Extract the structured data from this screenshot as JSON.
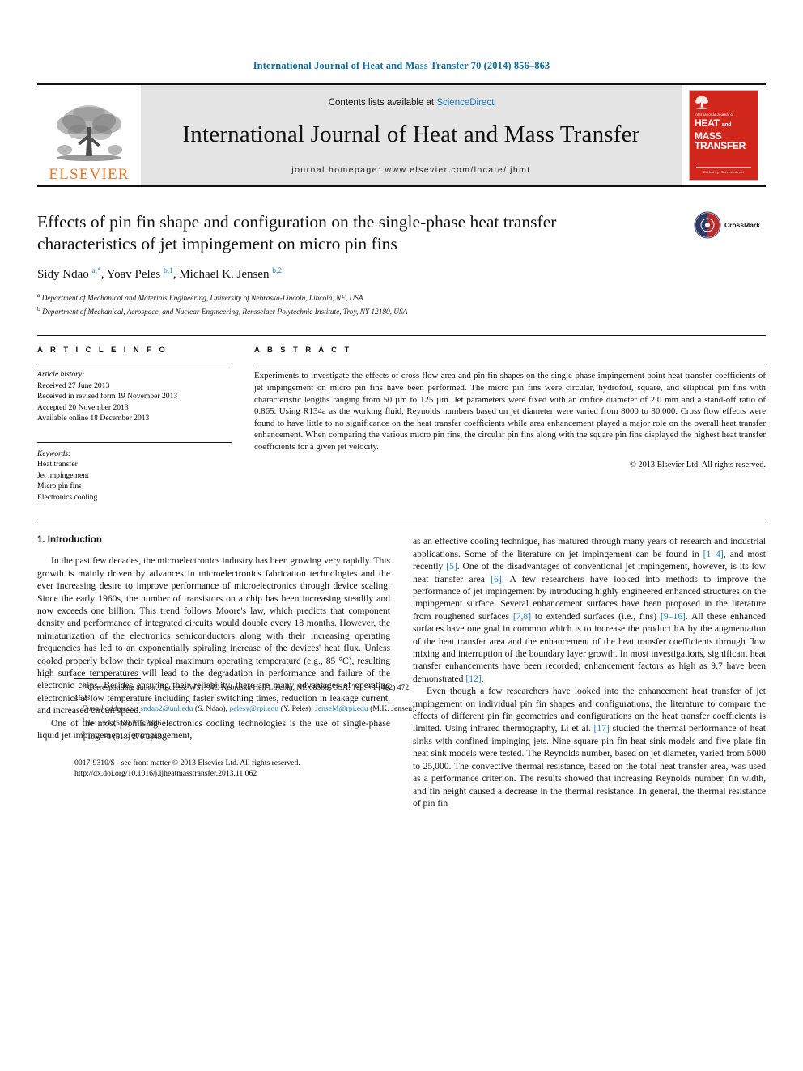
{
  "running_head": "International Journal of Heat and Mass Transfer 70 (2014) 856–863",
  "masthead": {
    "publisher": "ELSEVIER",
    "contents_prefix": "Contents lists available at ",
    "contents_link": "ScienceDirect",
    "journal_name": "International Journal of Heat and Mass Transfer",
    "homepage": "journal homepage: www.elsevier.com/locate/ijhmt",
    "cover": {
      "small_title": "International Journal of",
      "big_line1": "HEAT",
      "big_and": "and",
      "big_line1b": "MASS",
      "big_line2": "TRANSFER",
      "footer": "Edited by: Sciencedirect"
    }
  },
  "article": {
    "title": "Effects of pin fin shape and configuration on the single-phase heat transfer characteristics of jet impingement on micro pin fins",
    "authors_html": "Sidy Ndao <sup>a,*</sup>, Yoav Peles <sup>b,1</sup>, Michael K. Jensen <sup>b,2</sup>",
    "affiliation_a": "Department of Mechanical and Materials Engineering, University of Nebraska-Lincoln, Lincoln, NE, USA",
    "affiliation_b": "Department of Mechanical, Aerospace, and Nuclear Engineering, Rensselaer Polytechnic Institute, Troy, NY 12180, USA",
    "crossmark_label": "CrossMark"
  },
  "info": {
    "heading": "A R T I C L E    I N F O",
    "history_label": "Article history:",
    "history": [
      "Received 27 June 2013",
      "Received in revised form 19 November 2013",
      "Accepted 20 November 2013",
      "Available online 18 December 2013"
    ],
    "keywords_label": "Keywords:",
    "keywords": [
      "Heat transfer",
      "Jet impingement",
      "Micro pin fins",
      "Electronics cooling"
    ]
  },
  "abstract": {
    "heading": "A B S T R A C T",
    "text": "Experiments to investigate the effects of cross flow area and pin fin shapes on the single-phase impingement point heat transfer coefficients of jet impingement on micro pin fins have been performed. The micro pin fins were circular, hydrofoil, square, and elliptical pin fins with characteristic lengths ranging from 50 µm to 125 µm. Jet parameters were fixed with an orifice diameter of 2.0 mm and a stand-off ratio of 0.865. Using R134a as the working fluid, Reynolds numbers based on jet diameter were varied from 8000 to 80,000. Cross flow effects were found to have little to no significance on the heat transfer coefficients while area enhancement played a major role on the overall heat transfer enhancement. When comparing the various micro pin fins, the circular pin fins along with the square pin fins displayed the highest heat transfer coefficients for a given jet velocity.",
    "copyright": "© 2013 Elsevier Ltd. All rights reserved."
  },
  "body": {
    "section_title": "1. Introduction",
    "left_p1": "In the past few decades, the microelectronics industry has been growing very rapidly. This growth is mainly driven by advances in microelectronics fabrication technologies and the ever increasing desire to improve performance of microelectronics through device scaling. Since the early 1960s, the number of transistors on a chip has been increasing steadily and now exceeds one billion. This trend follows Moore's law, which predicts that component density and performance of integrated circuits would double every 18 months. However, the miniaturization of the electronics semiconductors along with their increasing operating frequencies has led to an exponentially spiraling increase of the devices' heat flux. Unless cooled properly below their typical maximum operating temperature (e.g., 85 °C), resulting high surface temperatures will lead to the degradation in performance and failure of the electronic chips. Besides ensuring their reliability, there are many advantages of operating electronics at low temperature including faster switching times, reduction in leakage current, and increased circuit speed.",
    "left_p2": "One of the most promising electronics cooling technologies is the use of single-phase liquid jet impingement. Jet impingement,",
    "right_p1_a": "as an effective cooling technique, has matured through many years of research and industrial applications. Some of the literature on jet impingement can be found in ",
    "right_ref_1_4": "[1–4]",
    "right_p1_b": ", and most recently ",
    "right_ref_5": "[5]",
    "right_p1_c": ". One of the disadvantages of conventional jet impingement, however, is its low heat transfer area ",
    "right_ref_6": "[6]",
    "right_p1_d": ". A few researchers have looked into methods to improve the performance of jet impingement by introducing highly engineered enhanced structures on the impingement surface. Several enhancement surfaces have been proposed in the literature from roughened surfaces ",
    "right_ref_78": "[7,8]",
    "right_p1_e": " to extended surfaces (i.e., fins) ",
    "right_ref_916": "[9–16]",
    "right_p1_f": ". All these enhanced surfaces have one goal in common which is to increase the product hA by the augmentation of the heat transfer area and the enhancement of the heat transfer coefficients through flow mixing and interruption of the boundary layer growth. In most investigations, significant heat transfer enhancements have been recorded; enhancement factors as high as 9.7 have been demonstrated ",
    "right_ref_12": "[12]",
    "right_p1_g": ".",
    "right_p2_a": "Even though a few researchers have looked into the enhancement heat transfer of jet impingement on individual pin fin shapes and configurations, the literature to compare the effects of different pin fin geometries and configurations on the heat transfer coefficients is limited. Using infrared thermography, Li et al. ",
    "right_ref_17": "[17]",
    "right_p2_b": " studied the thermal performance of heat sinks with confined impinging jets. Nine square pin fin heat sink models and five plate fin heat sink models were tested. The Reynolds number, based on jet diameter, varied from 5000 to 25,000. The convective thermal resistance, based on the total heat transfer area, was used as a performance criterion. The results showed that increasing Reynolds number, fin width, and fin height caused a decrease in the thermal resistance. In general, the thermal resistance of pin fin"
  },
  "footnotes": {
    "corresponding": "* Corresponding author. Address: W317.4C Nebraska Hall Lincoln, NE 68588, USA. Tel.: +1 (402) 472 1623.",
    "email_label": "E-mail addresses:",
    "email_1": "sndao2@unl.edu",
    "email_1_who": "(S. Ndao),",
    "email_2": "pelesy@rpi.edu",
    "email_2_who": "(Y. Peles),",
    "email_3": "JenseM@rpi.edu",
    "email_3_who": "(M.K. Jensen).",
    "tel_1_sup": "1",
    "tel_1": "Tel.: +1 (518) 276 2886.",
    "tel_2_sup": "2",
    "tel_2": "Tel.: +1 (518) 276 2843."
  },
  "imprint": {
    "issn_line": "0017-9310/$ - see front matter © 2013 Elsevier Ltd. All rights reserved.",
    "doi": "http://dx.doi.org/10.1016/j.ijheatmasstransfer.2013.11.062"
  },
  "colors": {
    "link": "#1a7bbd",
    "running_head": "#0b6fa4",
    "elsevier_orange": "#E87722",
    "cover_red": "#d1261b",
    "masthead_grey": "#e4e4e4"
  }
}
